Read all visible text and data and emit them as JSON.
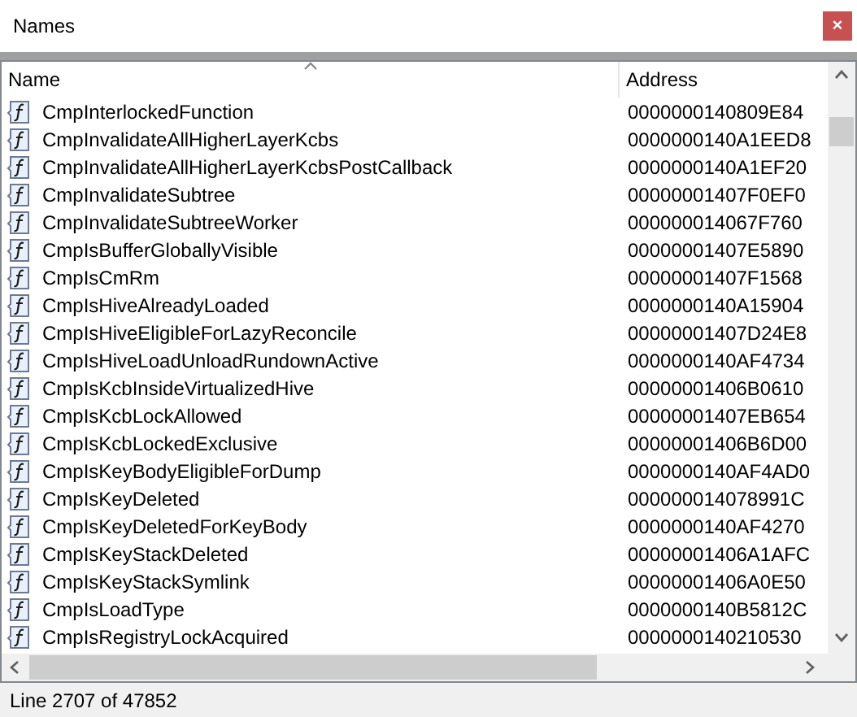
{
  "window": {
    "title": "Names",
    "close": "×"
  },
  "table": {
    "columns": [
      {
        "label": "Name",
        "sorted": true
      },
      {
        "label": "Address",
        "sorted": false
      }
    ],
    "rows": [
      {
        "name": "CmpInterlockedFunction",
        "address": "0000000140809E84"
      },
      {
        "name": "CmpInvalidateAllHigherLayerKcbs",
        "address": "0000000140A1EED8"
      },
      {
        "name": "CmpInvalidateAllHigherLayerKcbsPostCallback",
        "address": "0000000140A1EF20"
      },
      {
        "name": "CmpInvalidateSubtree",
        "address": "00000001407F0EF0"
      },
      {
        "name": "CmpInvalidateSubtreeWorker",
        "address": "000000014067F760"
      },
      {
        "name": "CmpIsBufferGloballyVisible",
        "address": "00000001407E5890"
      },
      {
        "name": "CmpIsCmRm",
        "address": "00000001407F1568"
      },
      {
        "name": "CmpIsHiveAlreadyLoaded",
        "address": "0000000140A15904"
      },
      {
        "name": "CmpIsHiveEligibleForLazyReconcile",
        "address": "00000001407D24E8"
      },
      {
        "name": "CmpIsHiveLoadUnloadRundownActive",
        "address": "0000000140AF4734"
      },
      {
        "name": "CmpIsKcbInsideVirtualizedHive",
        "address": "00000001406B0610"
      },
      {
        "name": "CmpIsKcbLockAllowed",
        "address": "00000001407EB654"
      },
      {
        "name": "CmpIsKcbLockedExclusive",
        "address": "00000001406B6D00"
      },
      {
        "name": "CmpIsKeyBodyEligibleForDump",
        "address": "0000000140AF4AD0"
      },
      {
        "name": "CmpIsKeyDeleted",
        "address": "000000014078991C"
      },
      {
        "name": "CmpIsKeyDeletedForKeyBody",
        "address": "0000000140AF4270"
      },
      {
        "name": "CmpIsKeyStackDeleted",
        "address": "00000001406A1AFC"
      },
      {
        "name": "CmpIsKeyStackSymlink",
        "address": "00000001406A0E50"
      },
      {
        "name": "CmpIsLoadType",
        "address": "0000000140B5812C"
      },
      {
        "name": "CmpIsRegistryLockAcquired",
        "address": "0000000140210530"
      }
    ]
  },
  "status_bar": "Line 2707 of 47852"
}
